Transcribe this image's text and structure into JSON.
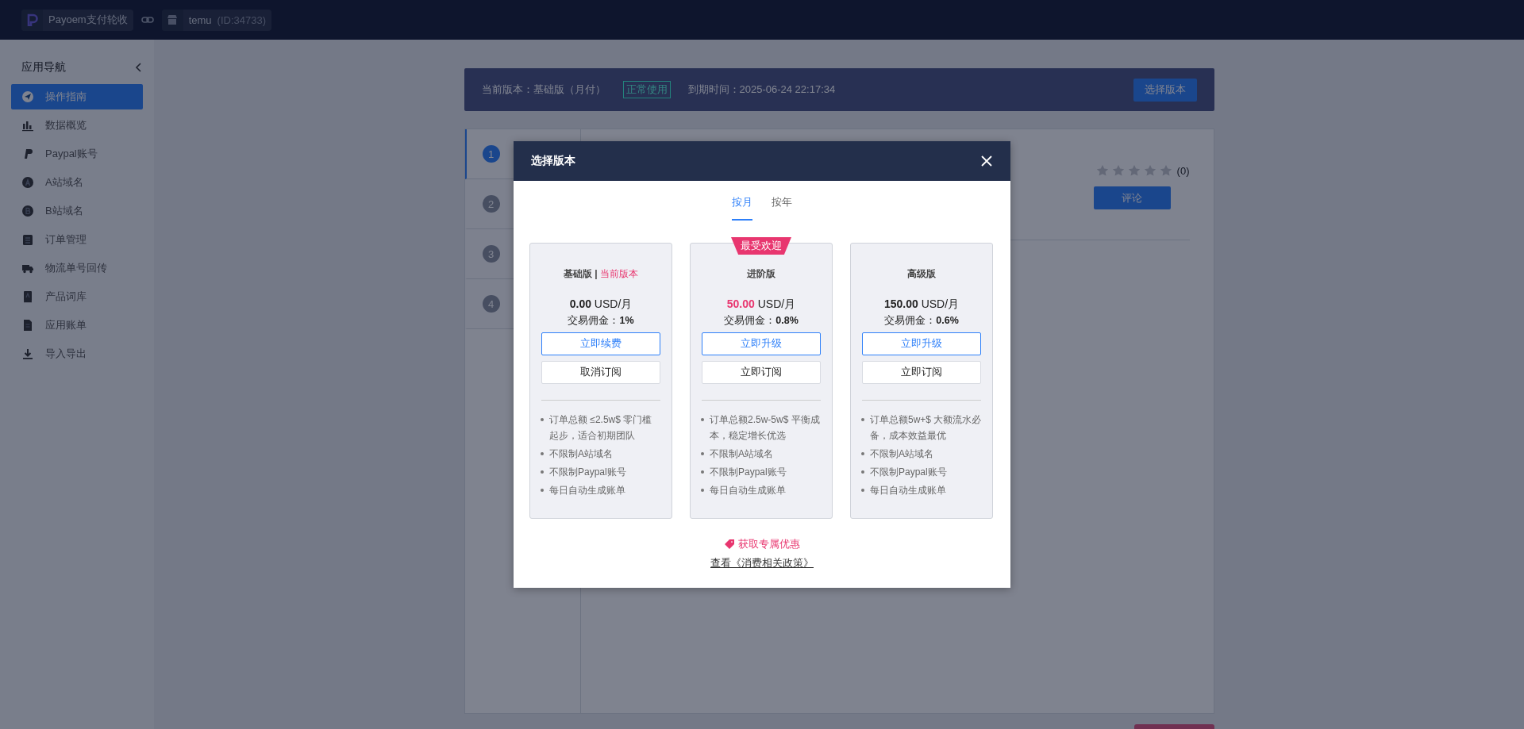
{
  "top_bar": {
    "app_name": "Payoem支付轮收",
    "store_name": "temu",
    "store_id": "(ID:34733)"
  },
  "sidebar": {
    "title": "应用导航",
    "items": [
      {
        "label": "操作指南",
        "selected": true
      },
      {
        "label": "数据概览",
        "selected": false
      },
      {
        "label": "Paypal账号",
        "selected": false
      },
      {
        "label": "A站域名",
        "selected": false
      },
      {
        "label": "B站域名",
        "selected": false
      },
      {
        "label": "订单管理",
        "selected": false
      },
      {
        "label": "物流单号回传",
        "selected": false
      },
      {
        "label": "产品词库",
        "selected": false
      },
      {
        "label": "应用账单",
        "selected": false
      },
      {
        "label": "导入导出",
        "selected": false
      }
    ]
  },
  "version_bar": {
    "current": "当前版本：基础版（月付）",
    "status": "正常使用",
    "expiry": "到期时间：2025-06-24 22:17:34",
    "button": "选择版本"
  },
  "steps": [
    {
      "number": "1",
      "selected": true
    },
    {
      "number": "2",
      "selected": false
    },
    {
      "number": "3",
      "selected": false
    },
    {
      "number": "4",
      "selected": false
    }
  ],
  "rating": {
    "stars": 0,
    "count": "(0)",
    "button": "评论"
  },
  "modal": {
    "title": "选择版本",
    "tabs": [
      {
        "label": "按月",
        "selected": true
      },
      {
        "label": "按年",
        "selected": false
      }
    ],
    "plans": [
      {
        "name": "基础版",
        "separator": "|",
        "current_tag": "当前版本",
        "featured": false,
        "price": "0.00",
        "unit": "USD/月",
        "commission_label": "交易佣金：",
        "commission": "1%",
        "primary_button": "立即续费",
        "secondary_button": "取消订阅",
        "features": [
          "订单总额 ≤2.5w$ 零门槛起步，适合初期团队",
          "不限制A站域名",
          "不限制Paypal账号",
          "每日自动生成账单"
        ]
      },
      {
        "name": "进阶版",
        "badge": "最受欢迎",
        "featured": true,
        "price": "50.00",
        "unit": "USD/月",
        "commission_label": "交易佣金：",
        "commission": "0.8%",
        "primary_button": "立即升级",
        "secondary_button": "立即订阅",
        "features": [
          "订单总额2.5w-5w$ 平衡成本，稳定增长优选",
          "不限制A站域名",
          "不限制Paypal账号",
          "每日自动生成账单"
        ]
      },
      {
        "name": "高级版",
        "featured": false,
        "price": "150.00",
        "unit": "USD/月",
        "commission_label": "交易佣金：",
        "commission": "0.6%",
        "primary_button": "立即升级",
        "secondary_button": "立即订阅",
        "features": [
          "订单总额5w+$ 大额流水必备，成本效益最优",
          "不限制A站域名",
          "不限制Paypal账号",
          "每日自动生成账单"
        ]
      }
    ],
    "offer_link": "获取专属优惠",
    "policy_link": "查看《消费相关政策》"
  }
}
